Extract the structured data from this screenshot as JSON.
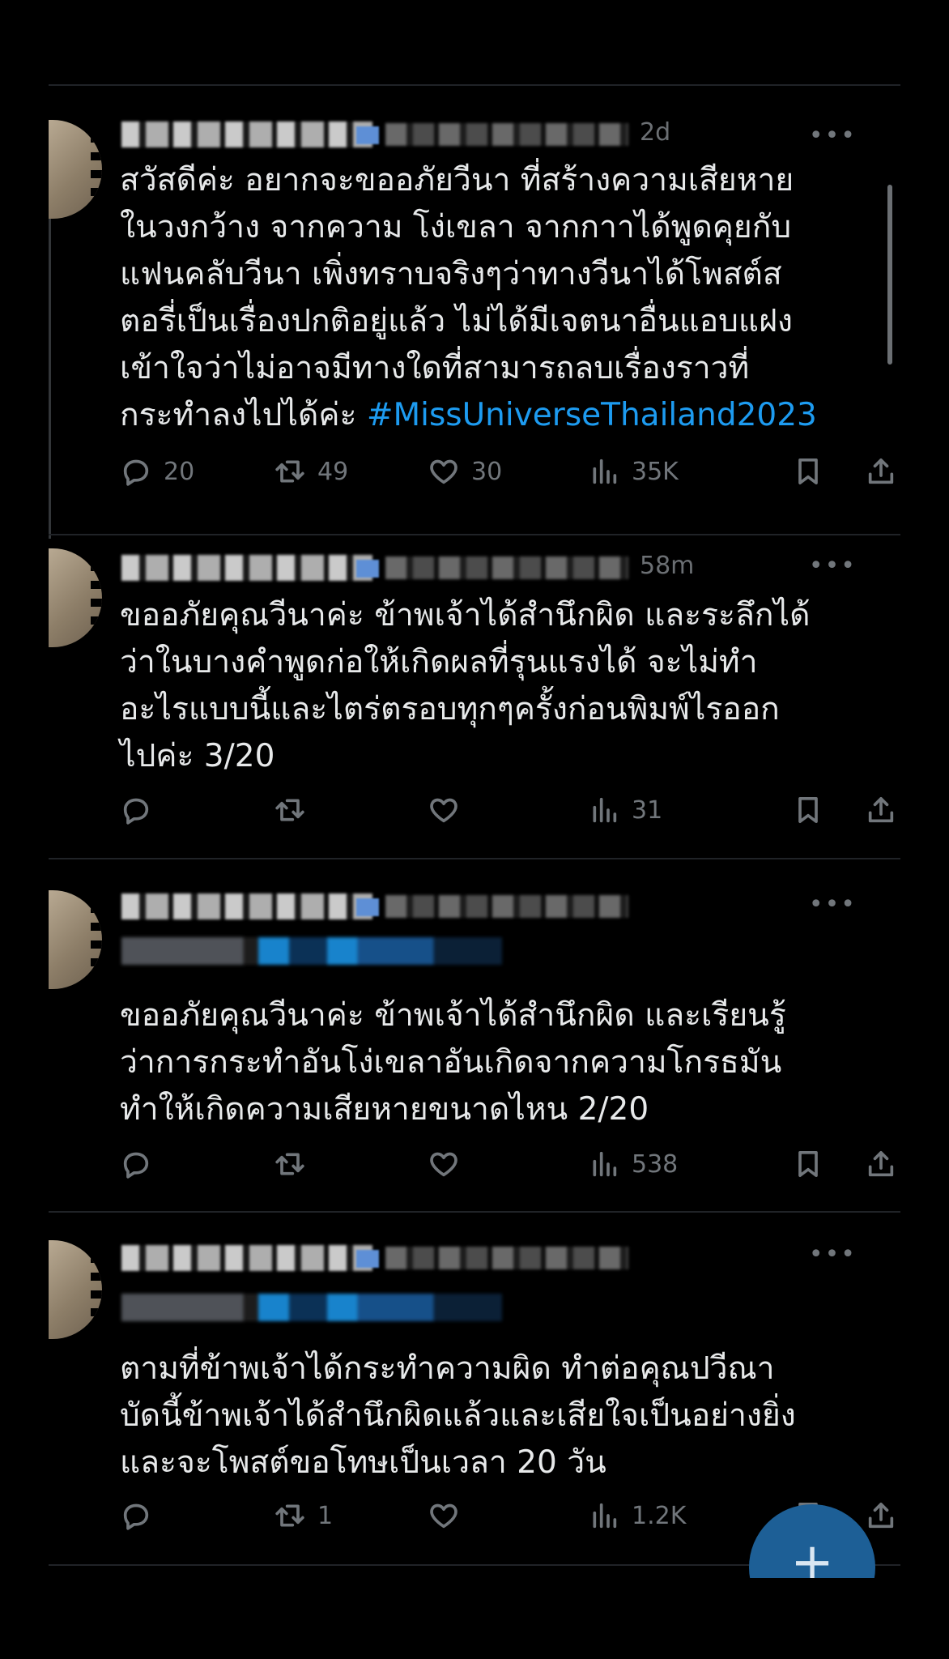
{
  "tweets": [
    {
      "time": "2d",
      "more": "•••",
      "text": "สวัสดีค่ะ อยากจะขออภัยวีนา ที่สร้างความเสียหาย\nในวงกว้าง จากความ โง่เขลา จากกาาได้พูดคุยกับ\nแฟนคลับวีนา เพิ่งทราบจริงๆว่าทางวีนาได้โพสต์ส\nตอรี่เป็นเรื่องปกติอยู่แล้ว ไม่ได้มีเจตนาอื่นแอบแฝง\nเข้าใจว่าไม่อาจมีทางใดที่สามารถลบเรื่องราวที่\nกระทำลงไปได้ค่ะ ",
      "hashtag": "#MissUniverseThailand2023",
      "replies": "20",
      "retweets": "49",
      "likes": "30",
      "views": "35K"
    },
    {
      "time": "58m",
      "more": "•••",
      "text": "ขออภัยคุณวีนาค่ะ ข้าพเจ้าได้สำนึกผิด และระลึกได้\nว่าในบางคำพูดก่อให้เกิดผลที่รุนแรงได้ จะไม่ทำ\nอะไรแบบนี้และไตร่ตรอบทุกๆครั้งก่อนพิมพ์ไรออก\nไปค่ะ 3/20",
      "replies": "",
      "retweets": "",
      "likes": "",
      "views": "31"
    },
    {
      "time": "",
      "more": "•••",
      "reply_prefix": "Replying",
      "text": "ขออภัยคุณวีนาค่ะ ข้าพเจ้าได้สำนึกผิด และเรียนรู้\nว่าการกระทำอันโง่เขลาอันเกิดจากความโกรธมัน\nทำให้เกิดความเสียหายขนาดไหน 2/20",
      "replies": "",
      "retweets": "",
      "likes": "",
      "views": "538"
    },
    {
      "time": "",
      "more": "•••",
      "text": "ตามที่ข้าพเจ้าได้กระทำความผิด ทำต่อคุณปวีณา\nบัดนี้ข้าพเจ้าได้สำนึกผิดแล้วและเสียใจเป็นอย่างยิ่ง\nและจะโพสต์ขอโทษเป็นเวลา 20 วัน",
      "replies": "",
      "retweets": "1",
      "likes": "",
      "views": "1.2K"
    }
  ],
  "fab": {
    "label": "+"
  },
  "colors": {
    "background": "#000000",
    "text": "#e7e9ea",
    "muted": "#71767b",
    "accent": "#1d9bf0",
    "fab": "#1d5f96"
  },
  "icons": [
    "reply-icon",
    "retweet-icon",
    "like-icon",
    "views-icon",
    "bookmark-icon",
    "share-icon",
    "more-icon",
    "compose-plus-icon"
  ]
}
